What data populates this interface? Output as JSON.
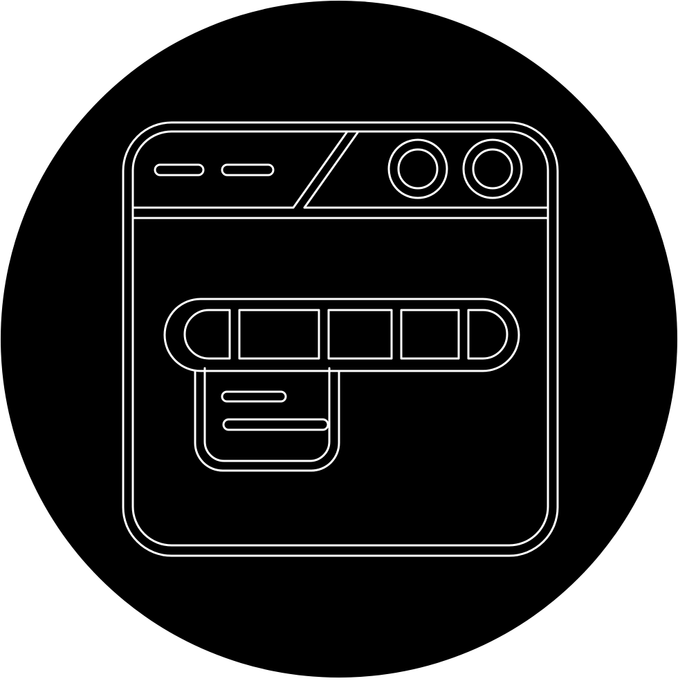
{
  "icon": {
    "name": "browser-navigation-menu-icon",
    "background_color": "#000000",
    "line_color": "#ffffff",
    "page_background": "#ffffff",
    "window_controls": [
      "dash-icon",
      "dash-icon",
      "circle-button-icon",
      "circle-button-icon"
    ],
    "menu_bar_segments": 5,
    "dropdown_text_lines": 2
  }
}
